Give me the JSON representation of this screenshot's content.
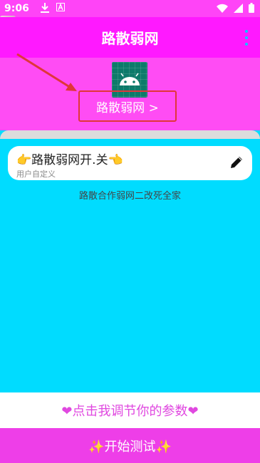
{
  "status_bar": {
    "time": "9:06"
  },
  "app_bar": {
    "title": "路散弱网"
  },
  "header": {
    "app_link_label": "路散弱网 >"
  },
  "card": {
    "title": "👉路散弱网开.关👈",
    "subtitle": "用户自定义"
  },
  "credit_text": "路散合作弱网二改死全家",
  "bottom": {
    "params_label": "❤点击我调节你的参数❤",
    "start_label": "✨开始测试✨"
  },
  "colors": {
    "app_bar": "#ff19ff",
    "header": "#ff4cf4",
    "body": "#00dcff",
    "start_button": "#ee3ee8",
    "highlight_border": "#e0363a"
  },
  "icons": [
    "download-icon",
    "font-icon",
    "wifi-icon",
    "signal-icon",
    "battery-icon",
    "more-vert-icon",
    "android-icon",
    "edit-pencil-icon"
  ]
}
